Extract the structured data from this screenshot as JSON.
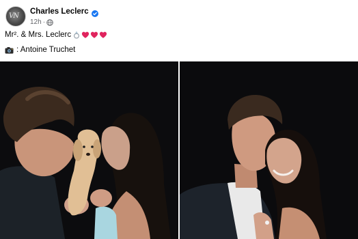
{
  "post": {
    "author": {
      "name": "Charles Leclerc",
      "verified": true,
      "avatar_text": "VN"
    },
    "meta": {
      "time": "12h",
      "separator": "·",
      "audience_icon": "globe-icon"
    },
    "caption": {
      "text": "Mr². & Mrs. Leclerc",
      "emojis": [
        "ring-icon",
        "heart-icon",
        "heart-icon",
        "heart-icon"
      ]
    },
    "credit": {
      "icon": "camera-icon",
      "text": ": Antoine Truchet"
    },
    "photos": [
      {
        "name": "couple-kissing-puppy-photo"
      },
      {
        "name": "couple-smiling-photo"
      }
    ]
  },
  "colors": {
    "verified_blue": "#1877f2",
    "heart_red": "#e0245e",
    "meta_gray": "#65676b",
    "photo_bg": "#0d0d0f"
  }
}
